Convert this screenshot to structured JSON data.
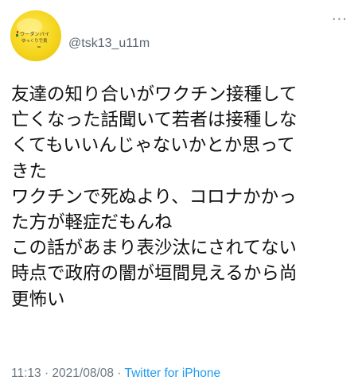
{
  "user": {
    "handle": "@tsk13_u11m",
    "avatar_text": [
      "ワーダンバイ",
      "ゆっくりで良"
    ]
  },
  "actions": {
    "more_icon": "more-dots-icon",
    "more_label": "···"
  },
  "tweet": {
    "lines": [
      "友達の知り合いがワクチン接種して",
      "亡くなった話聞いて若者は接種しな",
      "くてもいいんじゃないかとか思って",
      "きた",
      "ワクチンで死ぬより、コロナかかっ",
      "た方が軽症だもんね",
      "この話があまり表沙汰にされてない",
      "時点で政府の闇が垣間見えるから尚",
      "更怖い"
    ],
    "time": "11:13",
    "separator1": " · ",
    "date": "2021/08/08",
    "separator2": " · ",
    "source": "Twitter for iPhone"
  },
  "colors": {
    "text": "#111111",
    "secondary": "#5b6670",
    "link": "#1d9bf0",
    "avatar_bg": "#f5d51d"
  }
}
